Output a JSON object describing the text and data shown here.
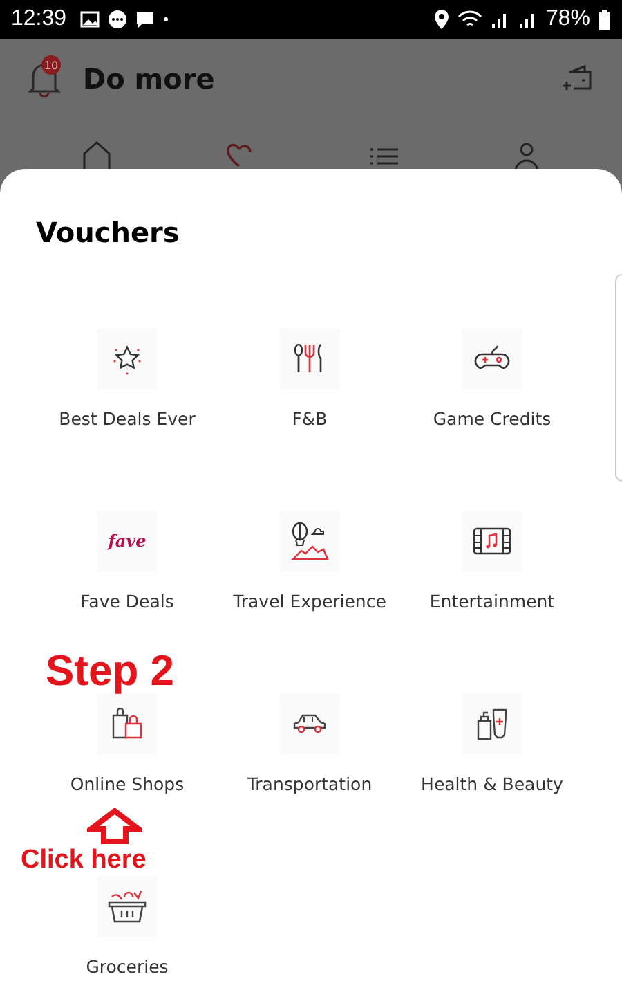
{
  "status_bar": {
    "time": "12:39",
    "battery": "78%"
  },
  "header": {
    "title": "Do more",
    "notification_count": "10"
  },
  "sheet": {
    "title": "Vouchers"
  },
  "vouchers": [
    {
      "label": "Best Deals Ever",
      "kind": "star"
    },
    {
      "label": "F&B",
      "kind": "cutlery"
    },
    {
      "label": "Game Credits",
      "kind": "gamepad"
    },
    {
      "label": "Fave Deals",
      "kind": "fave",
      "logo": "fave"
    },
    {
      "label": "Travel Experience",
      "kind": "balloon"
    },
    {
      "label": "Entertainment",
      "kind": "film"
    },
    {
      "label": "Online Shops",
      "kind": "bags"
    },
    {
      "label": "Transportation",
      "kind": "car"
    },
    {
      "label": "Health & Beauty",
      "kind": "bottles"
    },
    {
      "label": "Groceries",
      "kind": "basket"
    }
  ],
  "annotations": {
    "step": "Step 2",
    "hint": "Click here"
  }
}
